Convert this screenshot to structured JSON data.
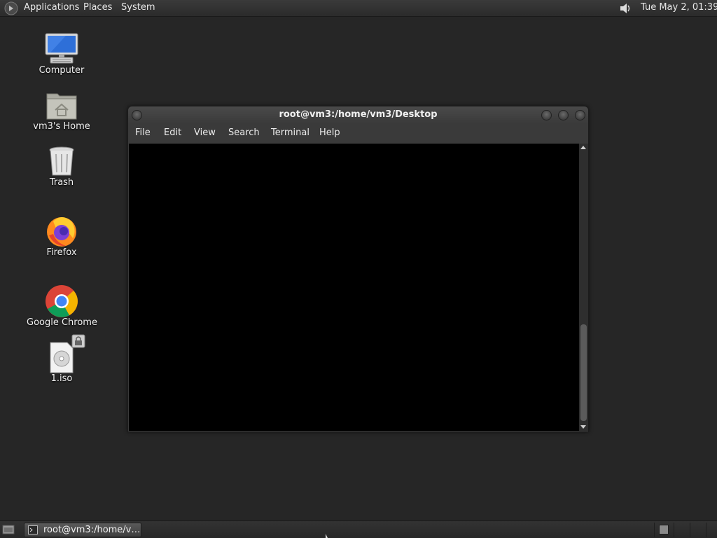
{
  "top_panel": {
    "menus": [
      "Applications",
      "Places",
      "System"
    ],
    "clock": "Tue May  2, 01:39",
    "icons": {
      "launcher": "gnome-foot-icon",
      "volume": "speaker-icon"
    }
  },
  "desktop": {
    "icons": [
      {
        "label": "Computer",
        "icon": "monitor-icon"
      },
      {
        "label": "vm3's Home",
        "icon": "home-folder-icon"
      },
      {
        "label": "Trash",
        "icon": "trash-icon"
      },
      {
        "label": "Firefox",
        "icon": "firefox-icon"
      },
      {
        "label": "Google Chrome",
        "icon": "chrome-icon"
      },
      {
        "label": "1.iso",
        "icon": "disc-image-icon"
      }
    ]
  },
  "terminal": {
    "title": "root@vm3:/home/vm3/Desktop",
    "menus": [
      "File",
      "Edit",
      "View",
      "Search",
      "Terminal",
      "Help"
    ],
    "content": ""
  },
  "bottom_panel": {
    "task_label": "root@vm3:/home/v…",
    "workspaces": 1
  },
  "colors": {
    "desktop_bg": "#262626",
    "panel_bg": "#2f2f2f",
    "terminal_bg": "#000000",
    "text": "#e8e8e8"
  }
}
